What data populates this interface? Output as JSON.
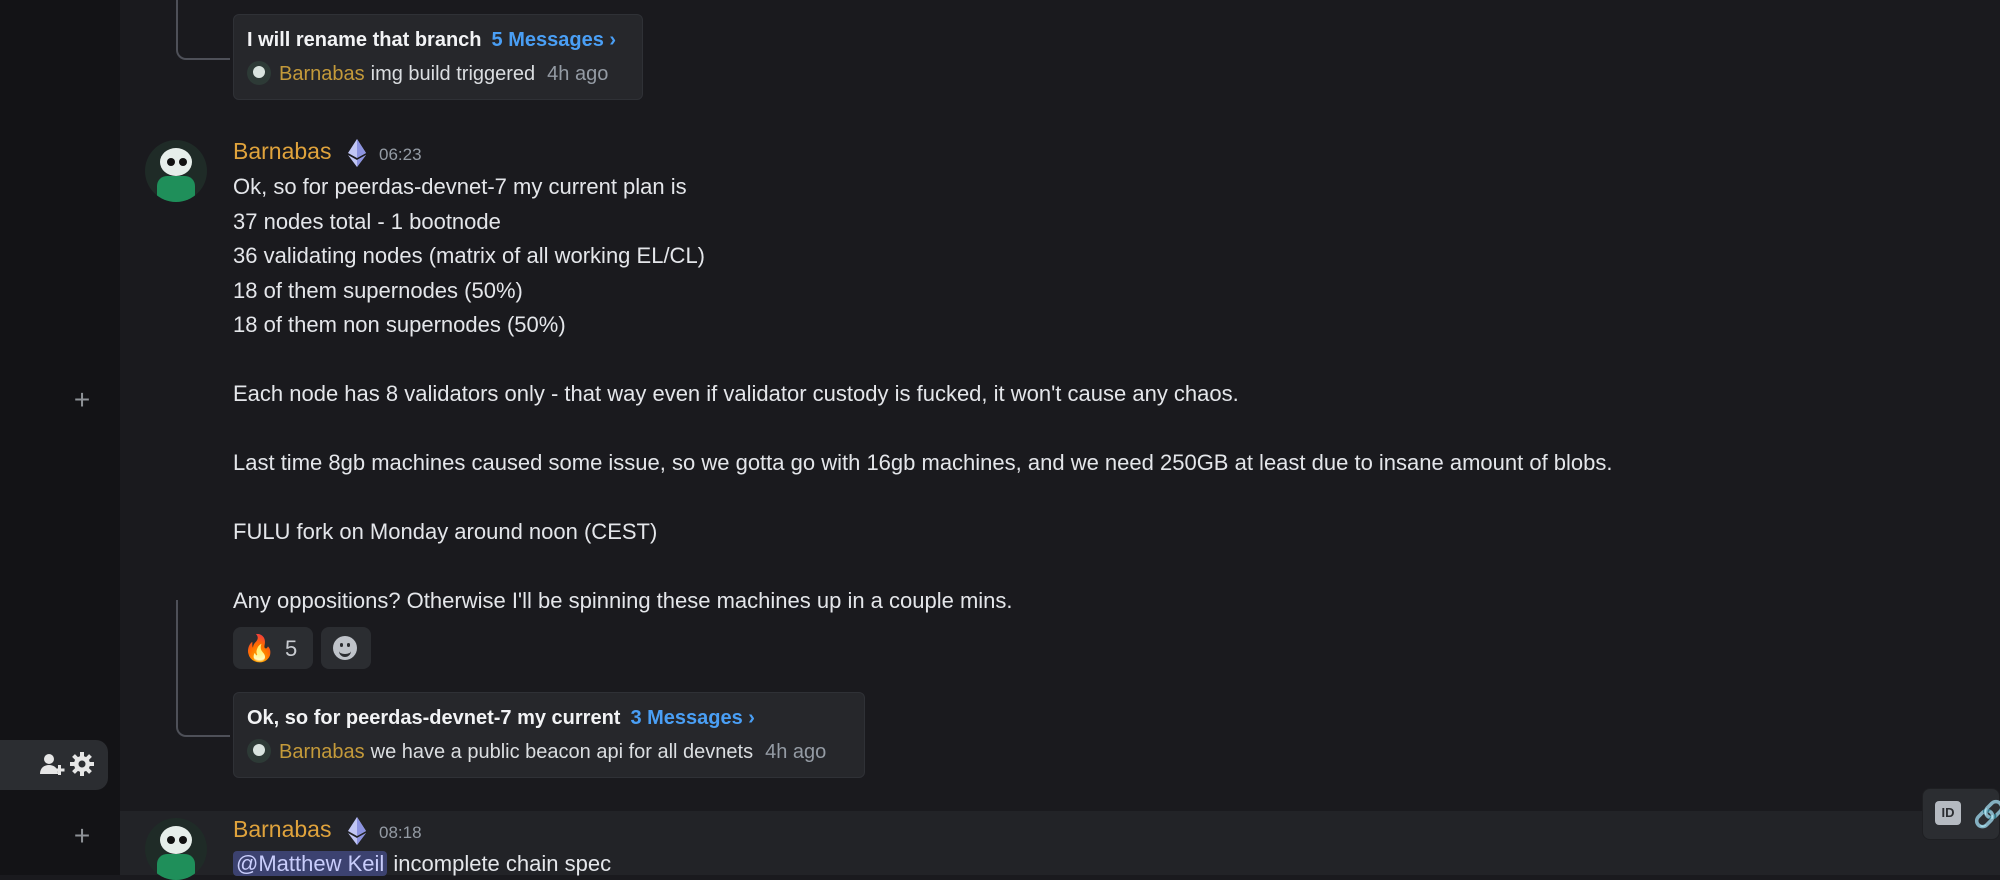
{
  "colors": {
    "background": "#1a1a1e",
    "username": "#e0a33c",
    "link": "#4a9ff5",
    "mention_bg": "#3c4270"
  },
  "icons": {
    "rail_plus": "plus-icon",
    "rail_add_user": "add-user-icon",
    "rail_settings": "gear-icon",
    "verified_badge": "ethereum-icon",
    "add_reaction": "smile-icon",
    "copy_id": "id-icon",
    "copy_link": "link-icon"
  },
  "thread1": {
    "title": "I will rename that branch",
    "count": "5 Messages ›",
    "last_author": "Barnabas",
    "last_text": "img build triggered",
    "last_time": "4h ago"
  },
  "message1": {
    "author": "Barnabas",
    "time": "06:23",
    "lines": [
      "Ok, so for peerdas-devnet-7 my current plan is",
      "37 nodes total - 1 bootnode",
      "36 validating nodes (matrix of all working EL/CL)",
      "18 of them supernodes (50%)",
      "18 of them non supernodes (50%)",
      "Each node has 8 validators only - that way even if validator custody is fucked, it won't cause any chaos.",
      "Last time 8gb machines caused some issue, so we gotta go with 16gb machines, and we need 250GB at least due to insane amount of blobs.",
      "FULU fork on Monday around noon (CEST)",
      "Any oppositions? Otherwise I'll be spinning these machines up in a couple mins."
    ],
    "reaction_emoji": "🔥",
    "reaction_count": "5"
  },
  "thread2": {
    "title": "Ok, so for peerdas-devnet-7 my current",
    "count": "3 Messages ›",
    "last_author": "Barnabas",
    "last_text": "we have a public beacon api for all devnets",
    "last_time": "4h ago"
  },
  "message2": {
    "author": "Barnabas",
    "time": "08:18",
    "mention": "@Matthew Keil",
    "text": "incomplete chain spec"
  },
  "toolbar": {
    "id_label": "ID"
  }
}
